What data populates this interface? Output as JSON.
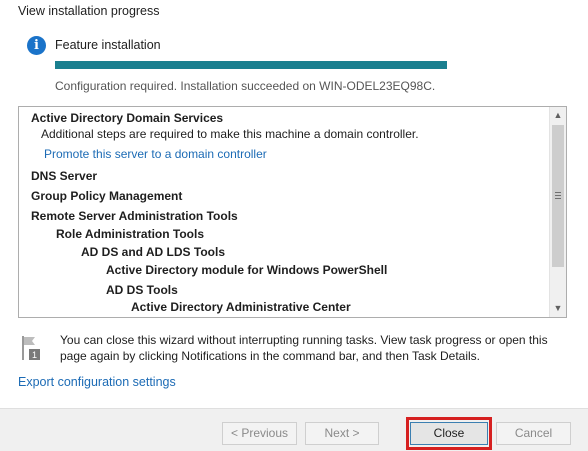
{
  "header": {
    "title": "View installation progress"
  },
  "progress": {
    "label": "Feature installation",
    "percent": 100,
    "status": "Configuration required. Installation succeeded on WIN-ODEL23EQ98C.",
    "fill_color": "#1a7f8f"
  },
  "results": {
    "ad_ds": "Active Directory Domain Services",
    "ad_ds_note": "Additional steps are required to make this machine a domain controller.",
    "promote_link": "Promote this server to a domain controller",
    "dns": "DNS Server",
    "gpm": "Group Policy Management",
    "rsat": "Remote Server Administration Tools",
    "role_tools": "Role Administration Tools",
    "adds_lds_tools": "AD DS and AD LDS Tools",
    "ad_ps_module": "Active Directory module for Windows PowerShell",
    "adds_tools": "AD DS Tools",
    "adac": "Active Directory Administrative Center"
  },
  "note": {
    "text": "You can close this wizard without interrupting running tasks. View task progress or open this page again by clicking Notifications in the command bar, and then Task Details.",
    "icon": "notification-flag-icon",
    "badge": "1"
  },
  "export_link": "Export configuration settings",
  "buttons": {
    "previous": "< Previous",
    "next": "Next >",
    "close": "Close",
    "cancel": "Cancel"
  },
  "colors": {
    "accent": "#1a73c9",
    "link": "#1c6bb5",
    "highlight": "#d62020"
  }
}
